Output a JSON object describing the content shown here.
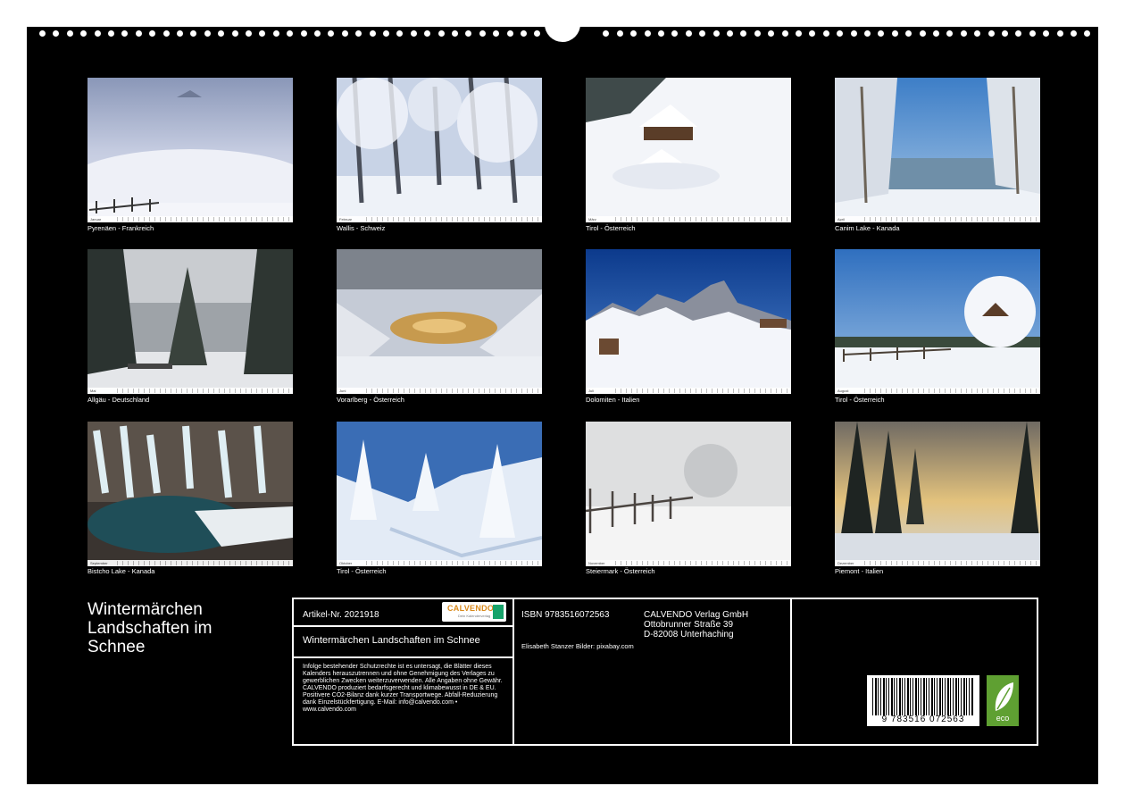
{
  "calendar_title": "Wintermärchen Landschaften im Schnee",
  "photos": [
    {
      "caption": "Pyrenäen - Frankreich",
      "month": "Januar"
    },
    {
      "caption": "Wallis - Schweiz",
      "month": "Februar"
    },
    {
      "caption": "Tirol - Österreich",
      "month": "März"
    },
    {
      "caption": "Canim Lake - Kanada",
      "month": "April"
    },
    {
      "caption": "Allgäu - Deutschland",
      "month": "Mai"
    },
    {
      "caption": "Vorarlberg - Österreich",
      "month": "Juni"
    },
    {
      "caption": "Dolomiten - Italien",
      "month": "Juli"
    },
    {
      "caption": "Tirol - Österreich",
      "month": "August"
    },
    {
      "caption": "Bistcho Lake - Kanada",
      "month": "September"
    },
    {
      "caption": "Tirol - Österreich",
      "month": "Oktober"
    },
    {
      "caption": "Steiermark - Österreich",
      "month": "November"
    },
    {
      "caption": "Piemont - Italien",
      "month": "Dezember"
    }
  ],
  "info": {
    "article": "Artikel-Nr. 2021918",
    "logo_name": "CALVENDO",
    "logo_tagline": "Dein Kalenderverlag",
    "subtitle": "Wintermärchen Landschaften im Schnee",
    "legal": "Infolge bestehender Schutzrechte ist es untersagt, die Blätter dieses Kalenders herauszutrennen und ohne Genehmigung des Verlages zu gewerblichen Zwecken weiterzuverwenden. Alle Angaben ohne Gewähr. CALVENDO produziert bedarfsgerecht und klimabewusst in DE & EU. Positivere CO2-Bilanz dank kurzer Transportwege. Abfall-Reduzierung dank Einzelstückfertigung. E-Mail: info@calvendo.com • www.calvendo.com",
    "isbn": "ISBN 9783516072563",
    "publisher_1": "CALVENDO Verlag GmbH",
    "publisher_2": "Ottobrunner Straße 39",
    "publisher_3": "D-82008 Unterhaching",
    "credits": "Elisabeth Stanzer Bilder: pixabay.com",
    "barcode_number": "9 783516 072563",
    "eco_label": "eco"
  }
}
